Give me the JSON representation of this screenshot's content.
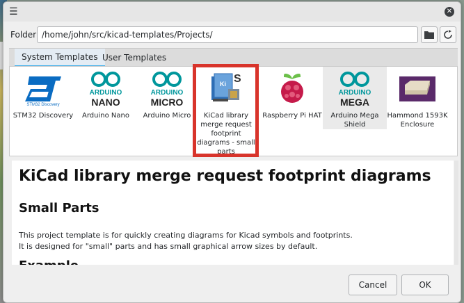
{
  "folder": {
    "label": "Folder:",
    "path": "/home/john/src/kicad-templates/Projects/"
  },
  "tabs": [
    {
      "label": "System Templates"
    },
    {
      "label": "User Templates"
    }
  ],
  "templates": [
    {
      "name": "STM32 Discovery",
      "icon": "st-logo"
    },
    {
      "name": "Arduino Nano",
      "icon": "arduino-logo",
      "line1": "ARDUINO",
      "line2": "NANO"
    },
    {
      "name": "Arduino Micro",
      "icon": "arduino-logo",
      "line1": "ARDUINO",
      "line2": "MICRO"
    },
    {
      "name": "KiCad library merge request footprint diagrams - small parts",
      "icon": "kicad-book-icon"
    },
    {
      "name": "Raspberry Pi HAT",
      "icon": "raspberry-pi-logo"
    },
    {
      "name": "Arduino Mega Shield",
      "icon": "arduino-logo",
      "line1": "ARDUINO",
      "line2": "MEGA"
    },
    {
      "name": "Hammond 1593K Enclosure",
      "icon": "enclosure-box"
    }
  ],
  "st_caption": "STM32 Discovery",
  "description": {
    "title": "KiCad library merge request footprint diagrams",
    "subtitle": "Small Parts",
    "para1": "This project template is for quickly creating diagrams for Kicad symbols and footprints.",
    "para2": "It is designed for \"small\" parts and has small graphical arrow sizes by default.",
    "cut_heading": "Example"
  },
  "buttons": {
    "cancel": "Cancel",
    "ok": "OK"
  },
  "colors": {
    "arduino": "#00979c",
    "highlight": "#d8342b",
    "selection": "#3daee9"
  }
}
